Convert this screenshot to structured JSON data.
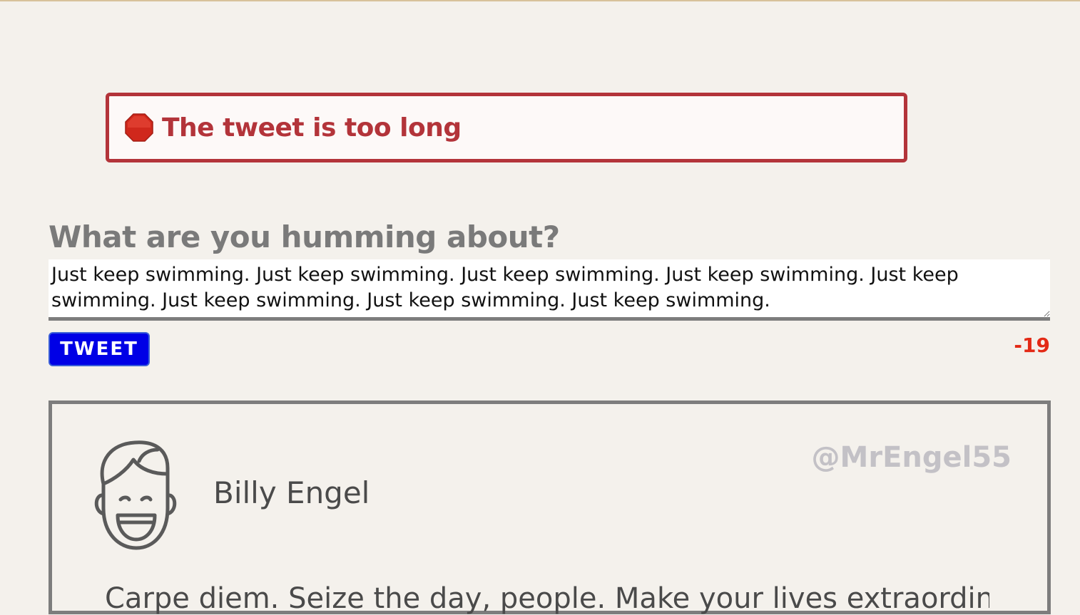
{
  "error": {
    "icon": "stop-sign-icon",
    "message": "The tweet is too long",
    "color": "#b3343a"
  },
  "composer": {
    "question": "What are you humming about?",
    "input_value": "Just keep swimming. Just keep swimming. Just keep swimming. Just keep swimming. Just keep swimming. Just keep swimming. Just keep swimming. Just keep swimming.",
    "button_label": "TWEET",
    "char_count": "-19",
    "count_color": "#e32a16",
    "button_color": "#0000e6"
  },
  "tweet": {
    "avatar_icon": "smiling-face-icon",
    "author_name": "Billy Engel",
    "handle": "@MrEngel55",
    "text": "Carpe diem. Seize the day, people. Make your lives extraordinary."
  }
}
